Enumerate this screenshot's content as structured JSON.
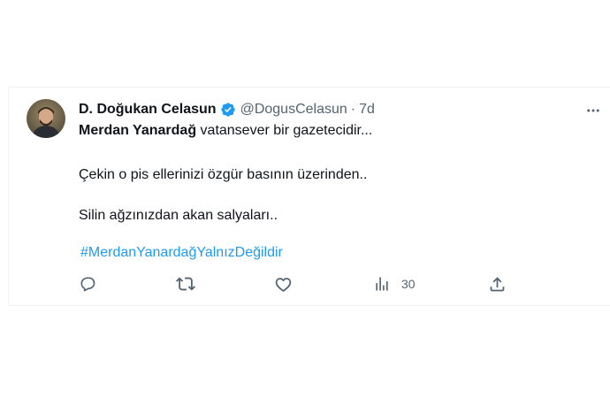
{
  "tweet": {
    "author": {
      "display_name": "D. Doğukan Celasun",
      "handle": "@DogusCelasun",
      "separator": "·",
      "time": "7d",
      "verified": true,
      "verified_color": "#1d9bf0"
    },
    "text": {
      "line1_bold": "Merdan Yanardağ",
      "line1_rest": " vatansever bir gazetecidir...",
      "line2": "Çekin o pis ellerinizi özgür basının üzerinden..",
      "line3": "Silin ağzınızdan akan salyaları..",
      "hashtag": "#MerdanYanardağYalnızDeğildir",
      "hashtag_color": "#1d9bf0"
    },
    "actions": {
      "reply_icon": "reply-icon",
      "retweet_icon": "retweet-icon",
      "like_icon": "heart-icon",
      "views_icon": "views-icon",
      "views_count": "30",
      "share_icon": "share-icon"
    },
    "more_icon": "more-icon"
  }
}
